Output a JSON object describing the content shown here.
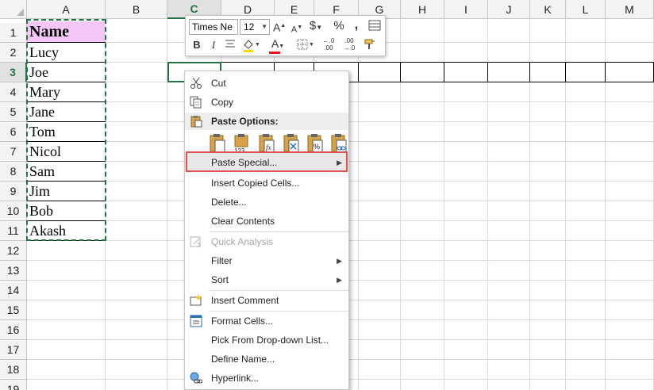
{
  "sheet": {
    "columns": [
      "A",
      "B",
      "C",
      "D",
      "E",
      "F",
      "G",
      "H",
      "I",
      "J",
      "K",
      "L",
      "M"
    ],
    "rows": [
      "1",
      "2",
      "3",
      "4",
      "5",
      "6",
      "7",
      "8",
      "9",
      "10",
      "11",
      "12",
      "13",
      "14",
      "15",
      "16",
      "17",
      "18",
      "19"
    ],
    "selected_column": "C",
    "selected_row": "3",
    "column_a": [
      "Name",
      "Lucy",
      "Joe",
      "Mary",
      "Jane",
      "Tom",
      "Nicol",
      "Sam",
      "Jim",
      "Bob",
      "Akash"
    ],
    "header_fill": "#f4c7f6",
    "accent": "#217346"
  },
  "mini_toolbar": {
    "font_name": "Times Ne",
    "font_size": "12",
    "grow_font": "A",
    "shrink_font": "A",
    "currency": "$",
    "percent": "%",
    "comma": ",",
    "bold": "B",
    "italic": "I",
    "font_color_letter": "A",
    "increase_decimal": "←.0\n.00",
    "decrease_decimal": ".00\n→.0",
    "icons": [
      "format-table-icon",
      "align-icon",
      "fill-color-icon",
      "borders-icon",
      "format-painter-icon"
    ],
    "font_color": "#e81123"
  },
  "context_menu": {
    "items": [
      {
        "label": "Cut",
        "icon": "scissors-icon"
      },
      {
        "label": "Copy",
        "icon": "copy-icon"
      },
      {
        "label": "Paste Options:",
        "icon": "clipboard-icon"
      },
      {
        "label": "Paste Special...",
        "icon": ""
      },
      {
        "label": "Insert Copied Cells...",
        "icon": ""
      },
      {
        "label": "Delete...",
        "icon": ""
      },
      {
        "label": "Clear Contents",
        "icon": ""
      },
      {
        "label": "Quick Analysis",
        "icon": "quick-analysis-icon"
      },
      {
        "label": "Filter",
        "icon": ""
      },
      {
        "label": "Sort",
        "icon": ""
      },
      {
        "label": "Insert Comment",
        "icon": "comment-icon"
      },
      {
        "label": "Format Cells...",
        "icon": "format-cells-icon"
      },
      {
        "label": "Pick From Drop-down List...",
        "icon": ""
      },
      {
        "label": "Define Name...",
        "icon": ""
      },
      {
        "label": "Hyperlink...",
        "icon": "hyperlink-icon"
      }
    ],
    "paste_option_icons": [
      "paste-icon",
      "paste-values-icon",
      "paste-formulas-icon",
      "paste-transpose-icon",
      "paste-formatting-icon",
      "paste-link-icon"
    ],
    "paste_value_badge": "123",
    "paste_formula_badge": "fx",
    "paste_formatting_badge": "%",
    "highlight_color": "#d9534f"
  }
}
